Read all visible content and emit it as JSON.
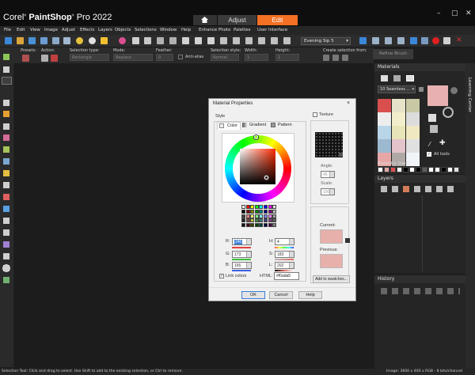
{
  "app": {
    "brand_prefix": "Corel",
    "brand_name": "PaintShop",
    "brand_suffix": "Pro 2022",
    "tabs": {
      "adjust": "Adjust",
      "edit": "Edit"
    },
    "window_controls": {
      "minimize": "–",
      "maximize": "▢",
      "close": "✕"
    }
  },
  "menu": [
    "File",
    "Edit",
    "View",
    "Image",
    "Adjust",
    "Effects",
    "Layers",
    "Objects",
    "Selections",
    "Window",
    "Help",
    "Enhance Photo",
    "Palettes",
    "User Interface"
  ],
  "toolbar": {
    "workspace": "Evening Sip 5",
    "accent": "#f37024"
  },
  "tool_options": {
    "presets": "Presets:",
    "action": "Action:",
    "selection_type": "Selection type:",
    "selection_type_value": "Rectangle",
    "mode": "Mode:",
    "mode_value": "Replace",
    "feather": "Feather:",
    "feather_value": "0",
    "antialias": "Anti-alias",
    "selection_style": "Selection style:",
    "selection_style_value": "Normal",
    "width": "Width:",
    "width_value": "1",
    "height": "Height:",
    "height_value": "1",
    "create_from": "Create selection from:",
    "refine": "Refine Brush"
  },
  "panels": {
    "materials": {
      "title": "Materials",
      "library": "10 Seamless ...",
      "all_tools": "All tools",
      "recently_used": "Recently Used",
      "swatches": [
        "#d94f4f",
        "#e6e3c9",
        "#c8c9a4",
        "#ededed",
        "#f2eecc",
        "#dcdcdc",
        "#b8d6e8",
        "#e7e4b8",
        "#f0e8c0",
        "#9cb9cf",
        "#e4c4cb",
        "#e0e0e0",
        "#e8a7a7",
        "#b0a8a4",
        "#f0f3f8"
      ],
      "recent": [
        "#ffffff",
        "#e3a6a6",
        "#d94f4f",
        "#ffffff",
        "#000000",
        "#ffffff",
        "#000000",
        "#5c5c5c",
        "#ffffff",
        "#ffffff",
        "#000000",
        "#ffffff",
        "#e0e0e0"
      ],
      "foreground": "#e8b0b0"
    },
    "layers": {
      "title": "Layers"
    },
    "history": {
      "title": "History"
    },
    "learning_center": "Learning Center"
  },
  "dialog": {
    "title": "Material Properties",
    "close": "×",
    "style": "Style",
    "tabs": [
      "Color",
      "Gradient",
      "Pattern"
    ],
    "texture": "Texture",
    "angle_label": "Angle:",
    "angle": "45",
    "scale_label": "Scale:",
    "scale": "100",
    "current": "Current:",
    "previous": "Previous:",
    "r_label": "R:",
    "r": "240",
    "g_label": "G:",
    "g": "173",
    "b_label": "B:",
    "b": "165",
    "h_label": "H:",
    "h": "4",
    "s_label": "S:",
    "s": "183",
    "l_label": "L:",
    "l": "202",
    "link_colors": "Link colors",
    "html_label": "HTML:",
    "html": "#f0ada5",
    "add_swatches": "Add to swatches...",
    "ok": "OK",
    "cancel": "Cancel",
    "help": "Help",
    "current_color": "#e8b0aa",
    "previous_color": "#e8b0aa"
  },
  "status": {
    "left": "Selection Tool: Click and drag to select. Use Shift to add to the existing selection, or Ctrl to remove.",
    "right": "Image: 3600 x 400 x RGB - 8 bits/channel"
  }
}
